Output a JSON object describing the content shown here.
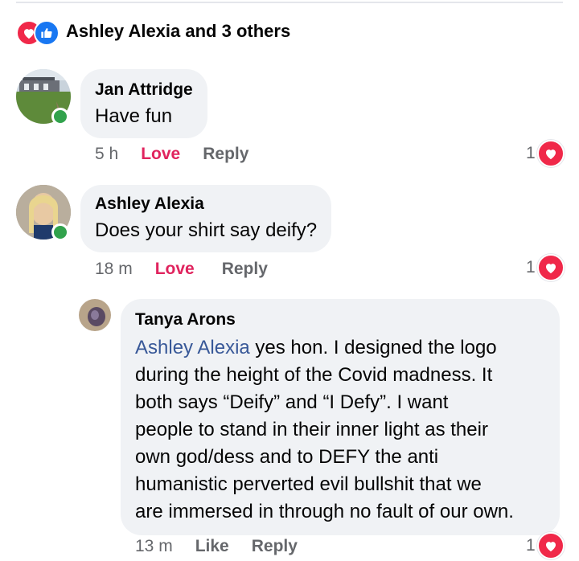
{
  "reactions": {
    "summary": "Ashley Alexia and 3 others",
    "icons": [
      "love-icon",
      "like-icon"
    ]
  },
  "comments": [
    {
      "author": "Jan Attridge",
      "text": "Have fun",
      "time": "5 h",
      "reaction_action": "Love",
      "reply_label": "Reply",
      "reaction_count": "1",
      "online": true
    },
    {
      "author": "Ashley Alexia",
      "text": "Does your shirt say deify?",
      "time": "18 m",
      "reaction_action": "Love",
      "reply_label": "Reply",
      "reaction_count": "1",
      "online": true
    }
  ],
  "reply": {
    "author": "Tanya Arons",
    "mention": "Ashley Alexia",
    "text": " yes hon.  I designed the logo\nduring the height of the Covid madness.  It\nboth says “Deify” and “I Defy”.  I want\npeople to stand in their inner light as their\nown god/dess and to DEFY  the anti\nhumanistic perverted evil bullshit that we\nare immersed in through no fault of our own.",
    "time": "13 m",
    "reaction_action": "Like",
    "reply_label": "Reply",
    "reaction_count": "1"
  },
  "colors": {
    "love": "#f02849",
    "like": "#1877f2",
    "love_text": "#e0245e",
    "mention": "#385898",
    "bubble": "#f0f2f5",
    "online": "#31a24c"
  }
}
